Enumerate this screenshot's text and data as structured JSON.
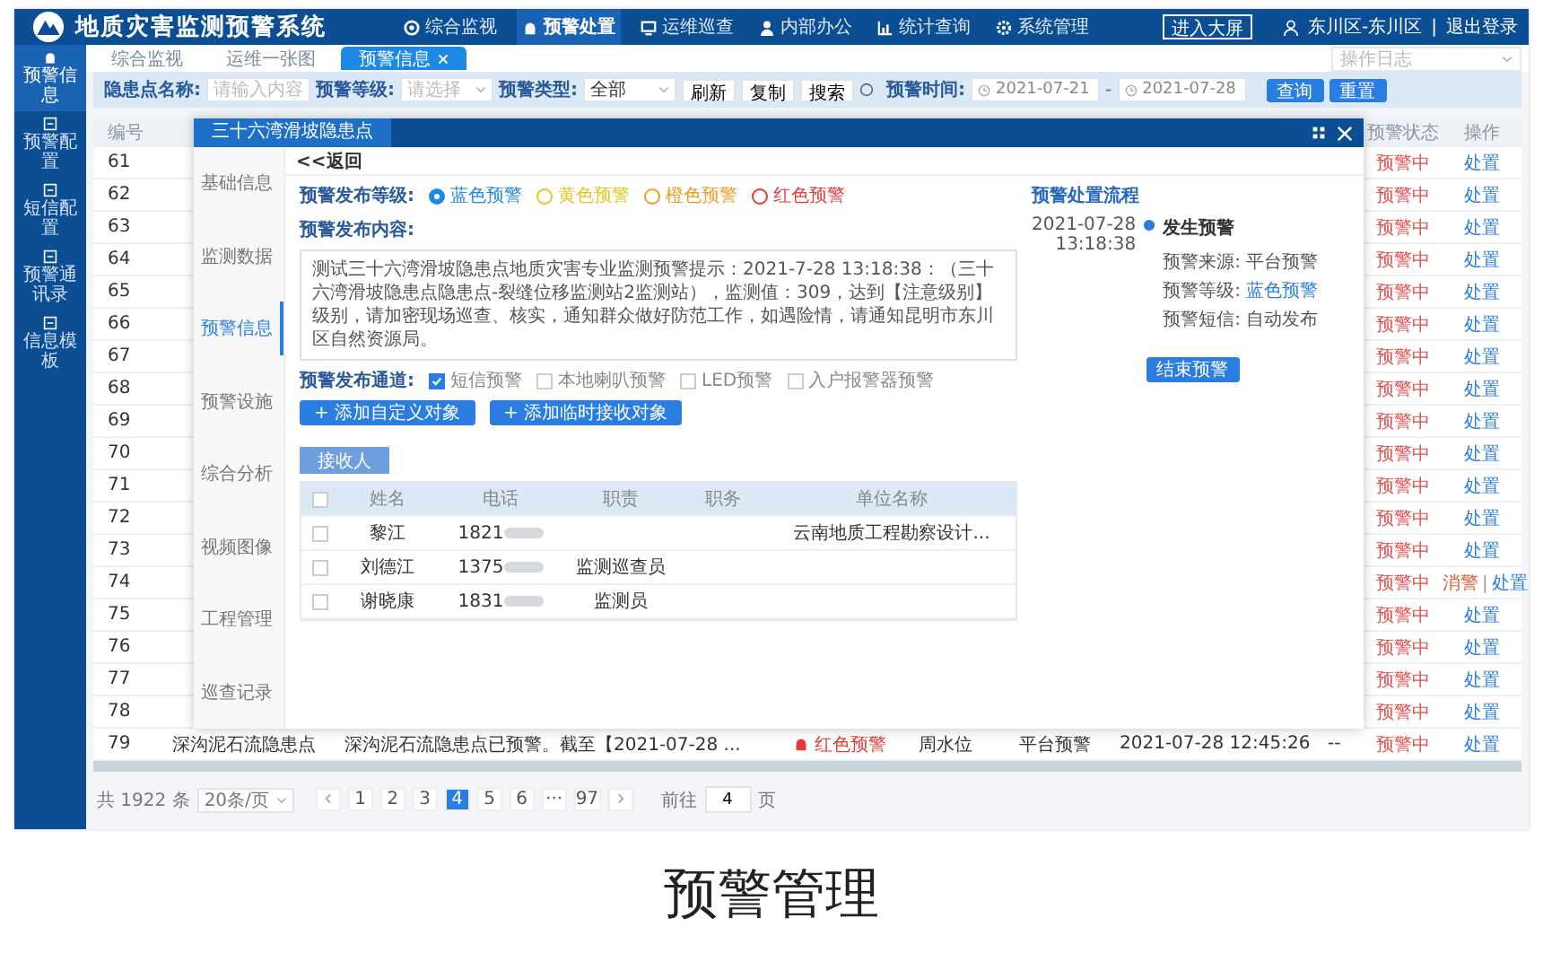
{
  "header": {
    "title": "地质灾害监测预警系统",
    "nav": [
      {
        "label": "综合监视",
        "selected": false
      },
      {
        "label": "预警处置",
        "selected": true
      },
      {
        "label": "运维巡查",
        "selected": false
      },
      {
        "label": "内部办公",
        "selected": false
      },
      {
        "label": "统计查询",
        "selected": false
      },
      {
        "label": "系统管理",
        "selected": false
      }
    ],
    "enter_button": "进入大屏",
    "user": "东川区-东川区",
    "separator": "|",
    "logout": "退出登录"
  },
  "sidebar": {
    "items": [
      {
        "label": "预警信息",
        "selected": true
      },
      {
        "label": "预警配置",
        "selected": false
      },
      {
        "label": "短信配置",
        "selected": false
      },
      {
        "label": "预警通讯录",
        "selected": false
      },
      {
        "label": "信息模板",
        "selected": false
      }
    ]
  },
  "tabs": [
    {
      "label": "综合监视",
      "selected": false,
      "closable": false
    },
    {
      "label": "运维一张图",
      "selected": false,
      "closable": false
    },
    {
      "label": "预警信息",
      "selected": true,
      "closable": true
    }
  ],
  "history_select": {
    "placeholder": "操作日志"
  },
  "filters": {
    "name": {
      "label": "隐患点名称:",
      "placeholder": "请输入内容"
    },
    "level": {
      "label": "预警等级:",
      "placeholder": "请选择"
    },
    "type": {
      "label": "预警类型:",
      "value": "全部"
    },
    "tools": [
      "刷新",
      "复制",
      "搜索"
    ],
    "time": {
      "label": "预警时间:",
      "start": "2021-07-21",
      "separator": "-",
      "end": "2021-07-28"
    },
    "buttons": [
      "查询",
      "重置"
    ]
  },
  "table": {
    "header_number": "编号",
    "header_status": "预警状态",
    "header_action": "操作",
    "rows": [
      {
        "number": "61",
        "status": "预警中",
        "actions": [
          {
            "label": "处置",
            "kind": "handle"
          }
        ]
      },
      {
        "number": "62",
        "status": "预警中",
        "actions": [
          {
            "label": "处置",
            "kind": "handle"
          }
        ]
      },
      {
        "number": "63",
        "status": "预警中",
        "actions": [
          {
            "label": "处置",
            "kind": "handle"
          }
        ]
      },
      {
        "number": "64",
        "status": "预警中",
        "actions": [
          {
            "label": "处置",
            "kind": "handle"
          }
        ]
      },
      {
        "number": "65",
        "status": "预警中",
        "actions": [
          {
            "label": "处置",
            "kind": "handle"
          }
        ]
      },
      {
        "number": "66",
        "status": "预警中",
        "actions": [
          {
            "label": "处置",
            "kind": "handle"
          }
        ]
      },
      {
        "number": "67",
        "status": "预警中",
        "actions": [
          {
            "label": "处置",
            "kind": "handle"
          }
        ]
      },
      {
        "number": "68",
        "status": "预警中",
        "actions": [
          {
            "label": "处置",
            "kind": "handle"
          }
        ]
      },
      {
        "number": "69",
        "status": "预警中",
        "actions": [
          {
            "label": "处置",
            "kind": "handle"
          }
        ]
      },
      {
        "number": "70",
        "status": "预警中",
        "actions": [
          {
            "label": "处置",
            "kind": "handle"
          }
        ]
      },
      {
        "number": "71",
        "status": "预警中",
        "actions": [
          {
            "label": "处置",
            "kind": "handle"
          }
        ]
      },
      {
        "number": "72",
        "status": "预警中",
        "actions": [
          {
            "label": "处置",
            "kind": "handle"
          }
        ]
      },
      {
        "number": "73",
        "status": "预警中",
        "actions": [
          {
            "label": "处置",
            "kind": "handle"
          }
        ]
      },
      {
        "number": "74",
        "status": "预警中",
        "separator": "|",
        "actions": [
          {
            "label": "消警",
            "kind": "dismiss"
          },
          {
            "label": "处置",
            "kind": "handle"
          }
        ]
      },
      {
        "number": "75",
        "status": "预警中",
        "actions": [
          {
            "label": "处置",
            "kind": "handle"
          }
        ]
      },
      {
        "number": "76",
        "status": "预警中",
        "actions": [
          {
            "label": "处置",
            "kind": "handle"
          }
        ]
      },
      {
        "number": "77",
        "status": "预警中",
        "actions": [
          {
            "label": "处置",
            "kind": "handle"
          }
        ]
      },
      {
        "number": "78",
        "status": "预警中",
        "actions": [
          {
            "label": "处置",
            "kind": "handle"
          }
        ]
      },
      {
        "number": "79",
        "status": "预警中",
        "actions": [
          {
            "label": "处置",
            "kind": "handle"
          }
        ],
        "cells": [
          {
            "kind": "text",
            "text": "深沟泥石流隐患点"
          },
          {
            "kind": "text",
            "text": "深沟泥石流隐患点已预警。截至【2021-07-28 ..."
          },
          {
            "kind": "level",
            "text": "红色预警",
            "color": "#e53935"
          },
          {
            "kind": "text",
            "text": "周水位"
          },
          {
            "kind": "text",
            "text": "平台预警"
          },
          {
            "kind": "text",
            "text": "2021-07-28 12:45:26"
          },
          {
            "kind": "text",
            "text": "--"
          }
        ]
      }
    ]
  },
  "modal": {
    "title": "三十六湾滑坡隐患点",
    "tabs": [
      {
        "label": "基础信息",
        "selected": false
      },
      {
        "label": "监测数据",
        "selected": false
      },
      {
        "label": "预警信息",
        "selected": true
      },
      {
        "label": "预警设施",
        "selected": false
      },
      {
        "label": "综合分析",
        "selected": false
      },
      {
        "label": "视频图像",
        "selected": false
      },
      {
        "label": "工程管理",
        "selected": false
      },
      {
        "label": "巡查记录",
        "selected": false
      }
    ],
    "back": "<<返回",
    "level_label": "预警发布等级:",
    "levels": [
      {
        "label": "蓝色预警",
        "color": "#1e88e5",
        "selected": true
      },
      {
        "label": "黄色预警",
        "color": "#e6c619",
        "selected": false
      },
      {
        "label": "橙色预警",
        "color": "#f29b1d",
        "selected": false
      },
      {
        "label": "红色预警",
        "color": "#e53935",
        "selected": false
      }
    ],
    "content_label": "预警发布内容:",
    "content": "测试三十六湾滑坡隐患点地质灾害专业监测预警提示：2021-7-28 13:18:38：（三十六湾滑坡隐患点隐患点-裂缝位移监测站2监测站），监测值：309，达到【注意级别】级别，请加密现场巡查、核实，通知群众做好防范工作，如遇险情，请通知昆明市东川区自然资源局。",
    "channel_label": "预警发布通道:",
    "channels": [
      {
        "label": "短信预警",
        "checked": true
      },
      {
        "label": "本地喇叭预警",
        "checked": false
      },
      {
        "label": "LED预警",
        "checked": false
      },
      {
        "label": "入户报警器预警",
        "checked": false
      }
    ],
    "add_buttons": [
      "+ 添加自定义对象",
      "+ 添加临时接收对象"
    ],
    "recipient_tab": "接收人",
    "recipients": {
      "all_selected": false,
      "columns": [
        "姓名",
        "电话",
        "职责",
        "职务",
        "单位名称"
      ],
      "rows": [
        {
          "selected": false,
          "name": "黎江",
          "phone": "1821",
          "blurred": true,
          "unit": "云南地质工程勘察设计..."
        },
        {
          "selected": false,
          "name": "刘德江",
          "phone": "1375",
          "blurred": true,
          "duty": "监测巡查员"
        },
        {
          "selected": false,
          "name": "谢晓康",
          "phone": "1831",
          "blurred": true,
          "duty": "监测员"
        }
      ]
    },
    "process": {
      "title": "预警处置流程",
      "date": "2021-07-28",
      "time": "13:18:38",
      "event": "发生预警",
      "details": [
        {
          "label": "预警来源:",
          "value": "平台预警",
          "kind": "plain"
        },
        {
          "label": "预警等级:",
          "value": "蓝色预警",
          "kind": "link"
        },
        {
          "label": "预警短信:",
          "value": "自动发布",
          "kind": "plain"
        }
      ],
      "end_button": "结束预警"
    }
  },
  "pagination": {
    "total": "共 1922 条",
    "page_size": "20条/页",
    "pages": [
      {
        "label": "1",
        "selected": false
      },
      {
        "label": "2",
        "selected": false
      },
      {
        "label": "3",
        "selected": false
      },
      {
        "label": "4",
        "selected": true
      },
      {
        "label": "5",
        "selected": false
      },
      {
        "label": "6",
        "selected": false
      },
      {
        "label": "···",
        "selected": false
      },
      {
        "label": "97",
        "selected": false
      }
    ],
    "goto_label": "前往",
    "goto_value": "4",
    "goto_suffix": "页"
  },
  "caption": "预警管理"
}
